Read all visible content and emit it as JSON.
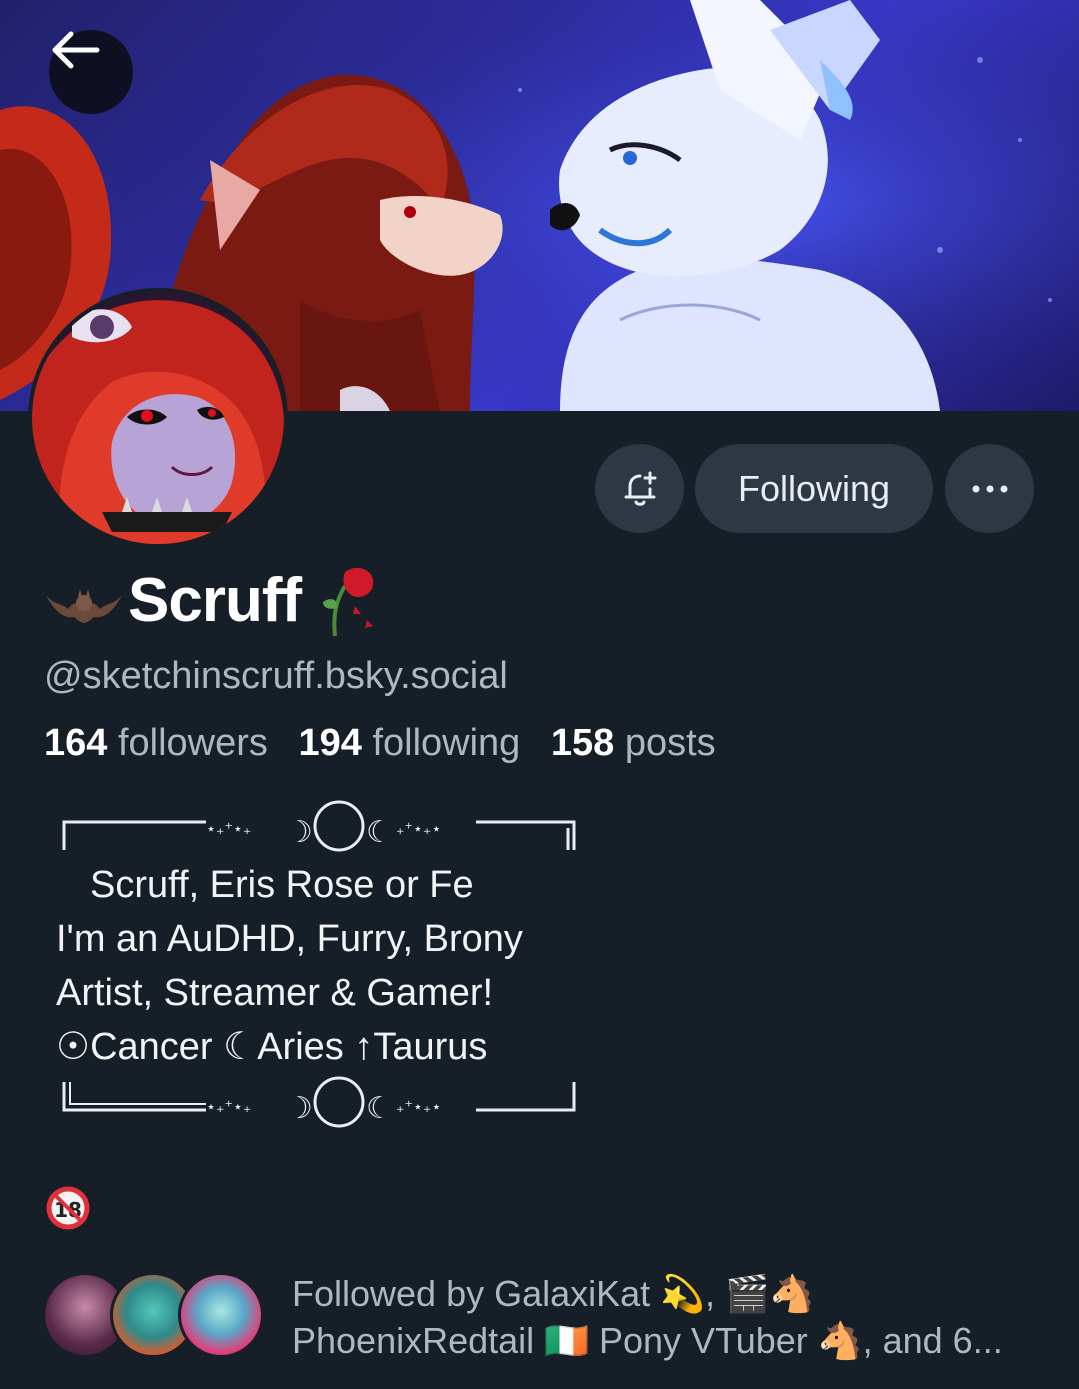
{
  "header": {
    "back_icon": "arrow-left-icon"
  },
  "profile": {
    "display_name": "Scruff",
    "name_prefix_emoji": "🦇",
    "name_suffix_emoji": "🥀",
    "handle": "@sketchinscruff.bsky.social"
  },
  "actions": {
    "notify_icon": "bell-plus-icon",
    "following_label": "Following",
    "more_icon": "ellipsis-icon"
  },
  "stats": {
    "followers_count": "164",
    "followers_label": "followers",
    "following_count": "194",
    "following_label": "following",
    "posts_count": "158",
    "posts_label": "posts"
  },
  "bio": {
    "top_frame": "┌───⋆⁺₊⋆☽◯☾⋆⁺₊⋆───┐",
    "lines": [
      "Scruff, Eris Rose or Fe",
      "I'm an AuDHD, Furry, Brony",
      "Artist, Streamer & Gamer!",
      "☉Cancer  ☾Aries ↑Taurus"
    ],
    "bottom_frame": "└───⋆⁺₊⋆☽◯☾⋆⁺₊⋆───┘"
  },
  "badges": {
    "under18_icon": "no-under-18-icon",
    "under18_text": "18"
  },
  "followed_by": {
    "line1_prefix": "Followed by GalaxiKat ",
    "line1_emoji": "💫",
    "line1_sep": ", ",
    "line1_emoji2": "🎬🐴",
    "line2_name": "PhoenixRedtail ",
    "line2_flag": "🇮🇪",
    "line2_name2": " Pony VTuber ",
    "line2_emoji": "🐴",
    "line2_suffix": ", and 6..."
  },
  "colors": {
    "background": "#161e27",
    "button_bg": "#2e3844",
    "muted_text": "#aeb8c2"
  }
}
